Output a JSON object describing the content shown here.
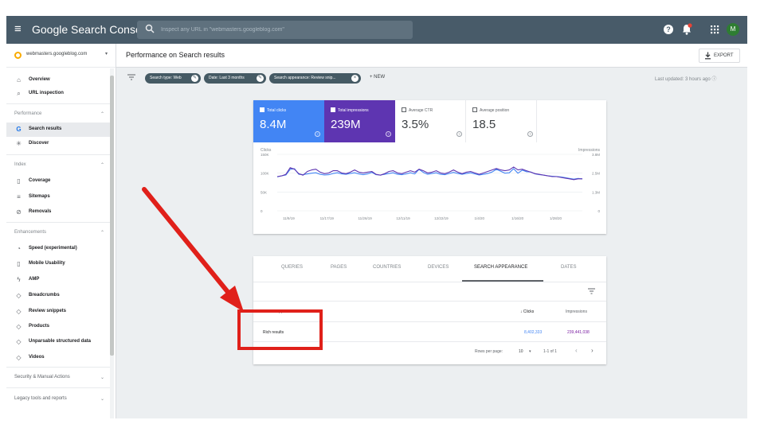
{
  "topbar": {
    "menu_icon": "≡",
    "brand": "Google Search Console",
    "search_placeholder": "Inspect any URL in \"webmasters.googleblog.com\"",
    "avatar_initial": "M",
    "icons": [
      "hamburger-menu-icon",
      "search-icon",
      "help-icon",
      "notifications-bell-icon",
      "apps-grid-icon",
      "account-avatar"
    ]
  },
  "sidebar": {
    "property": "webmasters.googleblog.com",
    "property_caret": "▾",
    "items": [
      {
        "label": "Overview",
        "icon": "⌂"
      },
      {
        "label": "URL inspection",
        "icon": "⌕"
      },
      {
        "label": "Search results",
        "icon": "G"
      },
      {
        "label": "Discover",
        "icon": "✳"
      },
      {
        "label": "Coverage",
        "icon": "▯"
      },
      {
        "label": "Sitemaps",
        "icon": "≡"
      },
      {
        "label": "Removals",
        "icon": "⊘"
      },
      {
        "label": "Speed (experimental)",
        "icon": "◔"
      },
      {
        "label": "Mobile Usability",
        "icon": "▯"
      },
      {
        "label": "AMP",
        "icon": "ϟ"
      },
      {
        "label": "Breadcrumbs",
        "icon": "◇"
      },
      {
        "label": "Review snippets",
        "icon": "◇"
      },
      {
        "label": "Products",
        "icon": "◇"
      },
      {
        "label": "Unparsable structured data",
        "icon": "◇"
      },
      {
        "label": "Videos",
        "icon": "◇"
      }
    ],
    "sections": {
      "performance": "Performance",
      "index": "Index",
      "enhancements": "Enhancements"
    },
    "footer": {
      "security": "Security & Manual Actions",
      "legacy": "Legacy tools and reports"
    },
    "chevron_up": "⌃",
    "chevron_down": "⌄",
    "active_item": "Search results"
  },
  "header": {
    "title": "Performance on Search results",
    "export_label": "EXPORT"
  },
  "filters": {
    "chips": [
      "Search type: Web",
      "Date: Last 3 months",
      "Search appearance: Review snip..."
    ],
    "new_label": "+  NEW",
    "last_updated": "Last updated: 3 hours ago ⓘ"
  },
  "metrics": [
    {
      "label": "Total clicks",
      "value": "8.4M",
      "selected": true,
      "color": "#4285f4"
    },
    {
      "label": "Total impressions",
      "value": "239M",
      "selected": true,
      "color": "#5e35b1"
    },
    {
      "label": "Average CTR",
      "value": "3.5%",
      "selected": false
    },
    {
      "label": "Average position",
      "value": "18.5",
      "selected": false
    }
  ],
  "chart_data": {
    "type": "line",
    "left_axis_title": "Clicks",
    "right_axis_title": "Impressions",
    "left_ticks": [
      "150K",
      "100K",
      "50K",
      "0"
    ],
    "right_ticks": [
      "3.8M",
      "2.5M",
      "1.3M",
      "0"
    ],
    "ylim_left": [
      0,
      150000
    ],
    "ylim_right": [
      0,
      3800000
    ],
    "x_ticks": [
      "11/9/19",
      "11/17/19",
      "11/26/19",
      "12/11/19",
      "12/22/19",
      "1/4/20",
      "1/16/20",
      "1/28/20"
    ],
    "series": [
      {
        "name": "Total clicks",
        "color": "#4285f4",
        "axis": "left",
        "values": [
          90000,
          93000,
          95000,
          110000,
          112000,
          97000,
          96000,
          98000,
          100000,
          101000,
          97000,
          95000,
          96000,
          99000,
          101000,
          98000,
          97000,
          99000,
          101000,
          98000,
          96000,
          98000,
          102000,
          96000,
          95000,
          97000,
          99000,
          101000,
          97000,
          96000,
          98000,
          101000,
          98000,
          110000,
          102000,
          97000,
          99000,
          101000,
          97000,
          96000,
          99000,
          102000,
          99000,
          97000,
          99000,
          101000,
          98000,
          95000,
          97000,
          99000,
          103000,
          110000,
          105000,
          100000,
          101000,
          112000,
          100000,
          108000,
          104000,
          103000,
          98000,
          96000,
          95000,
          93000,
          92000,
          91000,
          90000,
          88000,
          86000,
          84000,
          86000,
          85000
        ]
      },
      {
        "name": "Total impressions",
        "color": "#5e35b1",
        "axis": "right",
        "values": [
          2300000,
          2350000,
          2450000,
          2900000,
          2800000,
          2500000,
          2400000,
          2650000,
          2750000,
          2800000,
          2600000,
          2500000,
          2550000,
          2700000,
          2700000,
          2550000,
          2500000,
          2600000,
          2750000,
          2600000,
          2550000,
          2600000,
          2650000,
          2450000,
          2400000,
          2500000,
          2650000,
          2700000,
          2550000,
          2500000,
          2600000,
          2700000,
          2600000,
          2800000,
          2700000,
          2550000,
          2600000,
          2700000,
          2550000,
          2500000,
          2600000,
          2750000,
          2600000,
          2500000,
          2600000,
          2650000,
          2550000,
          2450000,
          2550000,
          2650000,
          2750000,
          2850000,
          2750000,
          2700000,
          2750000,
          2950000,
          2750000,
          2800000,
          2700000,
          2600000,
          2500000,
          2450000,
          2400000,
          2350000,
          2300000,
          2300000,
          2250000,
          2200000,
          2150000,
          2100000,
          2150000,
          2150000
        ]
      }
    ],
    "grid": true,
    "legend": "none"
  },
  "table": {
    "tabs": [
      "QUERIES",
      "PAGES",
      "COUNTRIES",
      "DEVICES",
      "SEARCH APPEARANCE",
      "DATES"
    ],
    "active_tab": "SEARCH APPEARANCE",
    "columns": [
      "Search Appearance",
      "↓ Clicks",
      "Impressions"
    ],
    "rows": [
      {
        "appearance": "Rich results",
        "clicks": "8,402,333",
        "impressions": "239,441,038"
      }
    ],
    "pagination": {
      "rows_per_page_label": "Rows per page:",
      "rows_per_page": "10",
      "caret": "▾",
      "range": "1-1 of 1",
      "prev": "‹",
      "next": "›"
    }
  },
  "annotation": {
    "arrow_color": "#e0201a",
    "box_color": "#e0201a"
  }
}
